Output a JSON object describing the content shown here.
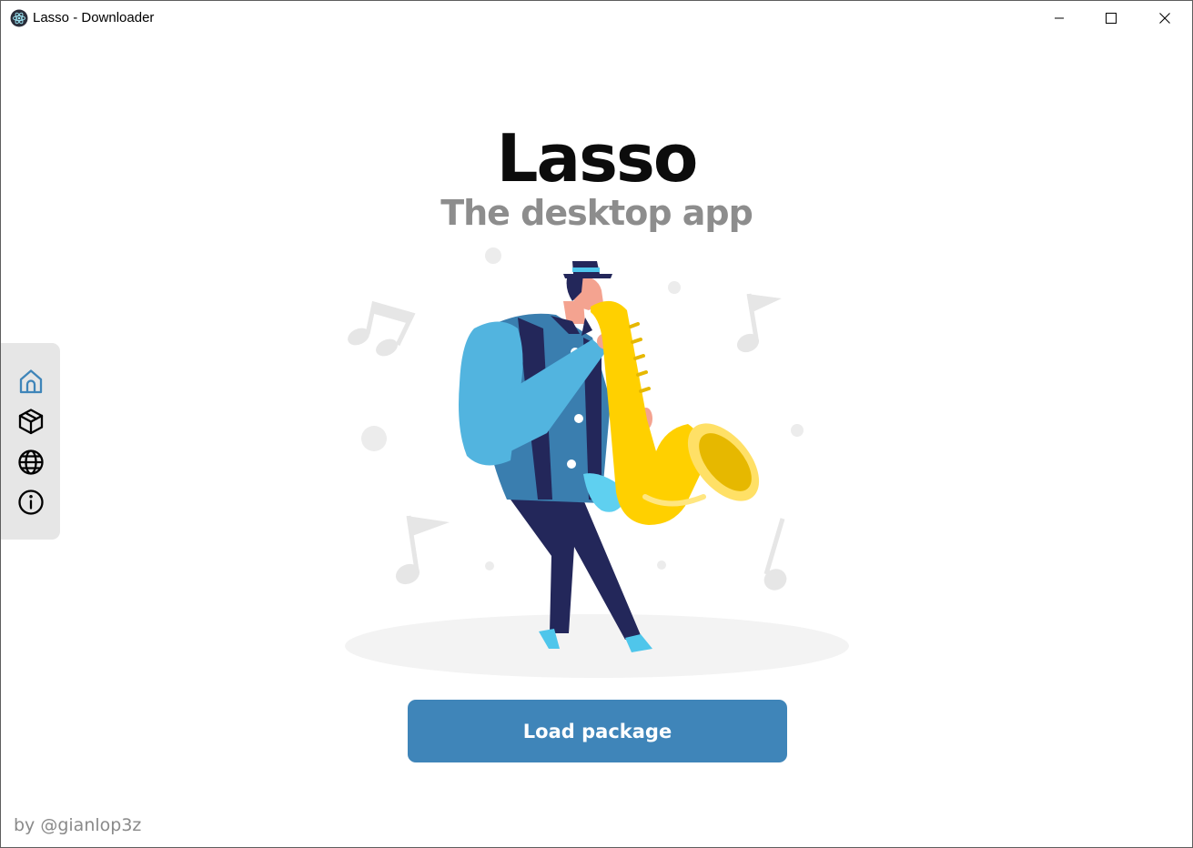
{
  "window": {
    "title": "Lasso - Downloader",
    "controls": {
      "minimize_icon": "minimize-icon",
      "maximize_icon": "maximize-icon",
      "close_icon": "close-icon"
    }
  },
  "sidebar": {
    "items": [
      {
        "name": "home",
        "icon": "home-icon",
        "active": true,
        "color": "#3f85b9"
      },
      {
        "name": "packages",
        "icon": "package-icon",
        "active": false
      },
      {
        "name": "web",
        "icon": "globe-icon",
        "active": false
      },
      {
        "name": "info",
        "icon": "info-icon",
        "active": false
      }
    ]
  },
  "main": {
    "title": "Lasso",
    "subtitle": "The desktop app",
    "illustration": "saxophone-player-illustration",
    "load_button_label": "Load package"
  },
  "footer": {
    "credit": "by @gianlop3z"
  },
  "colors": {
    "accent": "#3f85b9",
    "title": "#0c0c0c",
    "subtitle": "#8d8d8d",
    "sidebar_bg": "#e6e6e6"
  }
}
